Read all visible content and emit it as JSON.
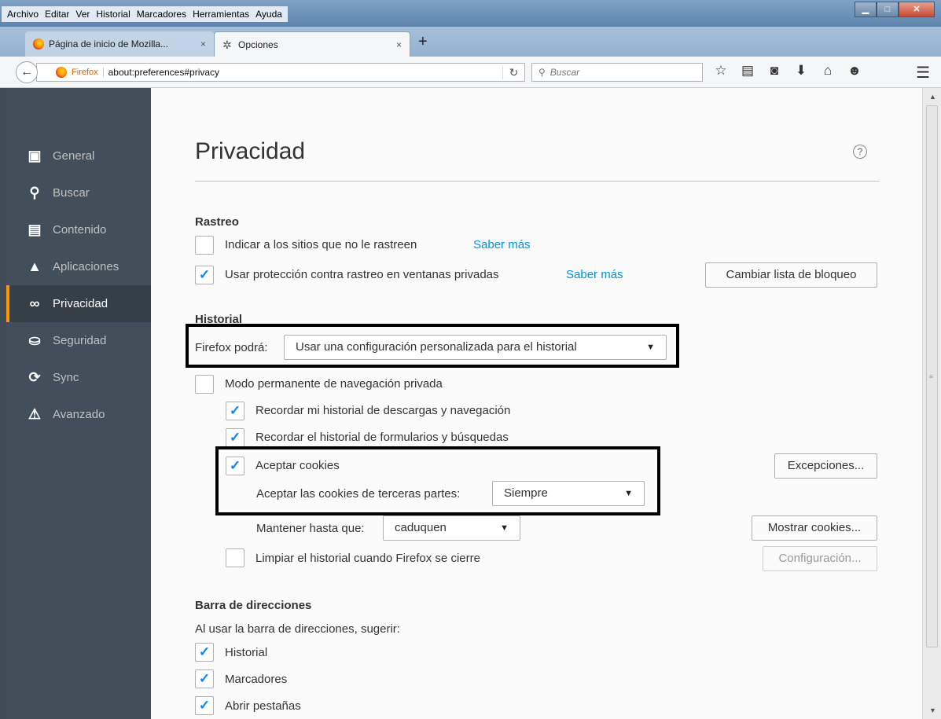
{
  "menubar": [
    "Archivo",
    "Editar",
    "Ver",
    "Historial",
    "Marcadores",
    "Herramientas",
    "Ayuda"
  ],
  "tabs": [
    {
      "label": "Página de inicio de Mozilla...",
      "close": "×"
    },
    {
      "label": "Opciones",
      "close": "×"
    }
  ],
  "newtab": "+",
  "urlbar": {
    "brand": "Firefox",
    "url": "about:preferences#privacy"
  },
  "searchbar": {
    "placeholder": "Buscar"
  },
  "sidebar": {
    "items": [
      {
        "label": "General",
        "icon": "general-icon"
      },
      {
        "label": "Buscar",
        "icon": "search-icon"
      },
      {
        "label": "Contenido",
        "icon": "document-icon"
      },
      {
        "label": "Aplicaciones",
        "icon": "rocket-icon"
      },
      {
        "label": "Privacidad",
        "icon": "mask-icon",
        "selected": true
      },
      {
        "label": "Seguridad",
        "icon": "lock-icon"
      },
      {
        "label": "Sync",
        "icon": "sync-icon"
      },
      {
        "label": "Avanzado",
        "icon": "wizard-icon"
      }
    ]
  },
  "page": {
    "title": "Privacidad",
    "help": "?",
    "tracking": {
      "heading": "Rastreo",
      "do_not_track": {
        "label": "Indicar a los sitios que no le rastreen",
        "checked": false,
        "link": "Saber más"
      },
      "private_protection": {
        "label": "Usar protección contra rastreo en ventanas privadas",
        "checked": true,
        "link": "Saber más"
      },
      "change_blocklist": "Cambiar lista de bloqueo"
    },
    "history": {
      "heading": "Historial",
      "firefox_will_label": "Firefox podrá:",
      "firefox_will_value": "Usar una configuración personalizada para el historial",
      "private_mode": {
        "label": "Modo permanente de navegación privada",
        "checked": false
      },
      "remember_downloads": {
        "label": "Recordar mi historial de descargas y navegación",
        "checked": true
      },
      "remember_forms": {
        "label": "Recordar el historial de formularios y búsquedas",
        "checked": true
      },
      "accept_cookies": {
        "label": "Aceptar cookies",
        "checked": true
      },
      "exceptions_button": "Excepciones...",
      "third_party_label": "Aceptar las cookies de terceras partes:",
      "third_party_value": "Siempre",
      "keep_until_label": "Mantener hasta que:",
      "keep_until_value": "caduquen",
      "show_cookies_button": "Mostrar cookies...",
      "clear_on_close": {
        "label": "Limpiar el historial cuando Firefox se cierre",
        "checked": false
      },
      "settings_button": "Configuración..."
    },
    "location_bar": {
      "heading": "Barra de direcciones",
      "suggest_label": "Al usar la barra de direcciones, sugerir:",
      "history": {
        "label": "Historial",
        "checked": true
      },
      "bookmarks": {
        "label": "Marcadores",
        "checked": true
      },
      "open_tabs": {
        "label": "Abrir pestañas",
        "checked": true
      }
    }
  },
  "colors": {
    "accent": "#ff9500",
    "link": "#0095dd",
    "check": "#0a84ff",
    "sidebar": "#424f5a"
  }
}
